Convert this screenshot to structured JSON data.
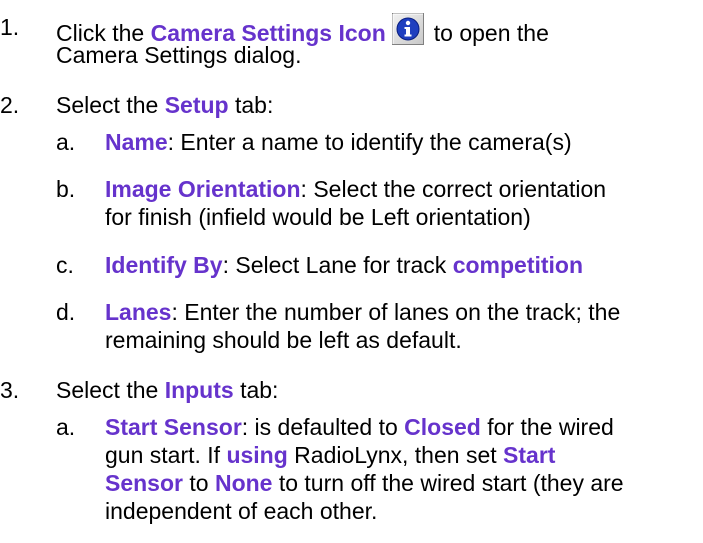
{
  "steps": [
    {
      "num": "1.",
      "t1": "Click the ",
      "b1": "Camera Settings Icon",
      "icon": "info-icon",
      "t2": "to open the",
      "line2": "Camera Settings dialog."
    },
    {
      "num": "2.",
      "t1": "Select the ",
      "b1": "Setup",
      "t2": " tab:",
      "subs": [
        {
          "letter": "a.",
          "b1": "Name",
          "t1": ": Enter a name to identify the camera(s)"
        },
        {
          "letter": "b.",
          "b1": "Image Orientation",
          "t1": ": Select the correct orientation",
          "line2": "for finish (infield would be Left orientation)"
        },
        {
          "letter": "c.",
          "b1": "Identify By",
          "t1": ": Select Lane for track ",
          "b2": "competition"
        },
        {
          "letter": "d.",
          "b1": "Lanes",
          "t1": ": Enter the number of lanes on the track; the",
          "line2": "remaining should be left as default."
        }
      ]
    },
    {
      "num": "3.",
      "t1": "Select the ",
      "b1": "Inputs",
      "t2": " tab:",
      "subs": [
        {
          "letter": "a.",
          "b1": "Start Sensor",
          "t1": ": is defaulted to ",
          "b2": "Closed",
          "t2": " for the wired",
          "l2a": "gun start. If ",
          "l2b": "using",
          "l2c": " RadioLynx, then set ",
          "l2d": "Start",
          "l3a": "Sensor",
          "l3b": " to ",
          "l3c": "None",
          "l3d": " to turn off the wired start (they are",
          "line4": "independent of each other."
        }
      ]
    }
  ],
  "colors": {
    "bold_text": "#6633cc",
    "icon_blue": "#1f3fbf"
  }
}
